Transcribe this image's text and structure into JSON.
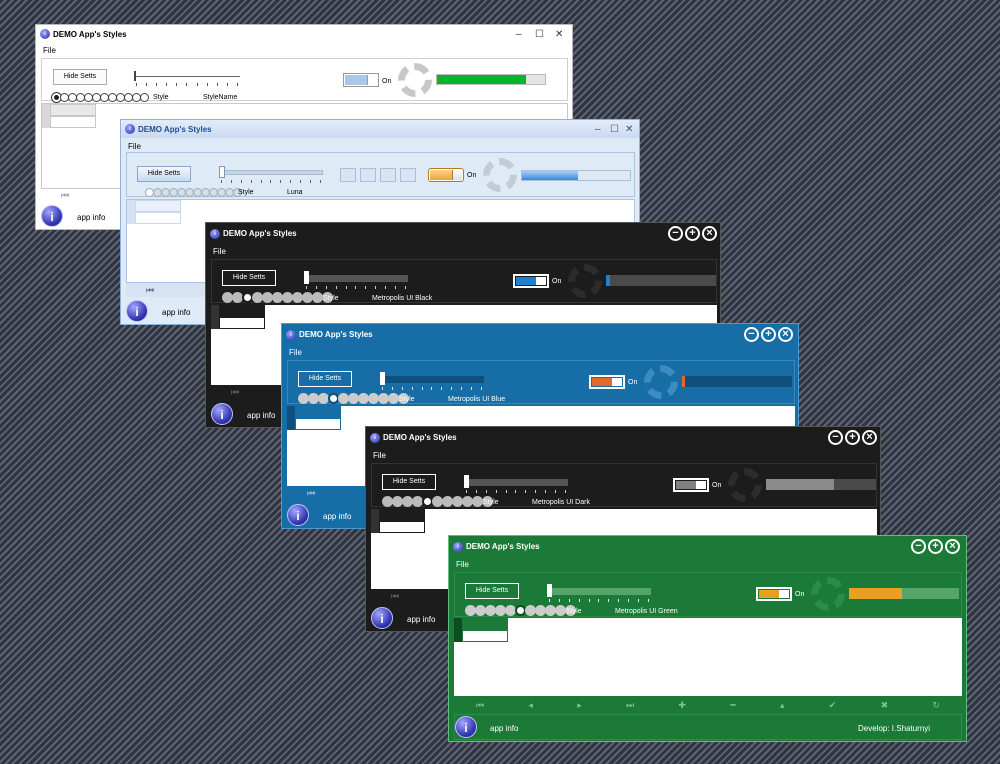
{
  "app_title": "DEMO App's Styles",
  "menu_file": "File",
  "hide_setts": "Hide Setts",
  "style_label": "Style",
  "on_label": "On",
  "app_info": "app info",
  "developer": "Develop: I.Shaturnyi",
  "icon_glyph": "i",
  "caption_glyphs": {
    "minimize": "–",
    "maximize": "☐",
    "close": "✕",
    "min_circle": "−",
    "max_circle": "+",
    "close_circle": "×"
  },
  "nav_glyphs": [
    "⏮",
    "◂",
    "▸",
    "⏭",
    "✚",
    "━",
    "▴",
    "✔",
    "✖",
    "↻"
  ],
  "windows": [
    {
      "id": "default",
      "style_name": "StyleName",
      "progress": 0.82,
      "accent": "#00b62a",
      "bg": "#ffffff"
    },
    {
      "id": "luna",
      "style_name": "Luna",
      "progress": 0.52,
      "accent": "#4c93dc",
      "bg": "#dfeaf7"
    },
    {
      "id": "metro-black",
      "style_name": "Metropolis UI Black",
      "progress": 0.0,
      "accent": "#1f82d0",
      "bg": "#1c1c1c"
    },
    {
      "id": "metro-blue",
      "style_name": "Metropolis UI Blue",
      "progress": 0.03,
      "accent": "#e06a2e",
      "bg": "#176ea6"
    },
    {
      "id": "metro-dark",
      "style_name": "Metropolis UI Dark",
      "progress": 0.62,
      "accent": "#808080",
      "bg": "#1c1c1c"
    },
    {
      "id": "metro-green",
      "style_name": "Metropolis UI Green",
      "progress": 0.48,
      "accent": "#e8a020",
      "bg": "#1b7a37"
    }
  ]
}
